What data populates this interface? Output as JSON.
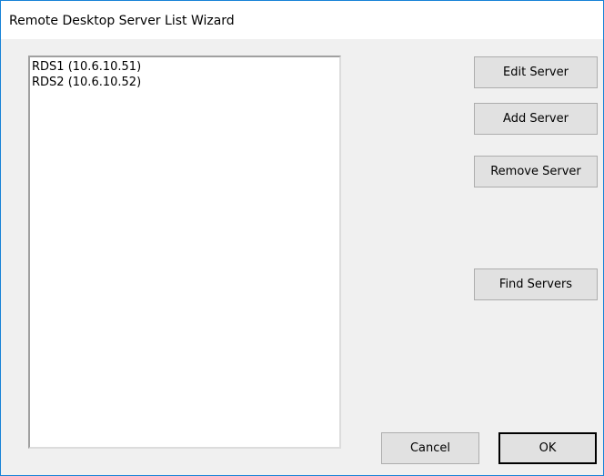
{
  "window": {
    "title": "Remote Desktop Server List Wizard"
  },
  "server_list": {
    "items": [
      {
        "label": "RDS1 (10.6.10.51)"
      },
      {
        "label": "RDS2 (10.6.10.52)"
      }
    ]
  },
  "actions": {
    "edit_label": "Edit Server",
    "add_label": "Add Server",
    "remove_label": "Remove Server",
    "find_label": "Find Servers"
  },
  "footer": {
    "cancel_label": "Cancel",
    "ok_label": "OK"
  }
}
